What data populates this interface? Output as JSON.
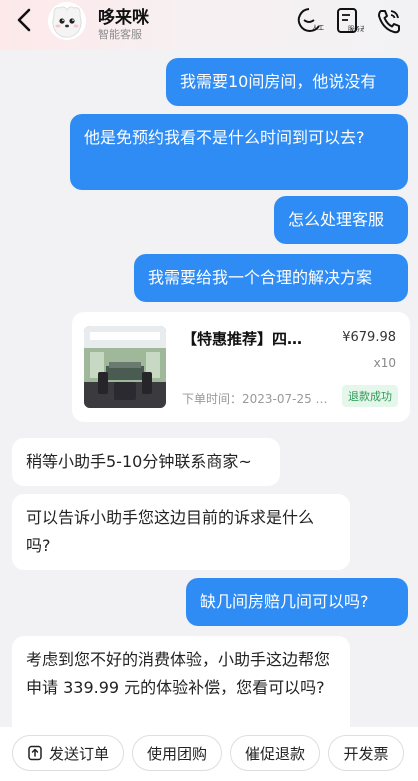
{
  "header": {
    "title": "哆来咪",
    "subtitle": "智能客服",
    "human_service_label": "人工客服",
    "progress_label": "服务进度"
  },
  "messages": [
    {
      "from": "me",
      "text": "我需要10间房间，他说没有"
    },
    {
      "from": "me",
      "text": "他是免预约我看不是什么时间到可以去?"
    },
    {
      "from": "me",
      "text": "怎么处理客服"
    },
    {
      "from": "me",
      "text": "我需要给我一个合理的解决方案"
    },
    {
      "from": "bot",
      "text": "稍等小助手5-10分钟联系商家~"
    },
    {
      "from": "bot",
      "text": "可以告诉小助手您这边目前的诉求是什么吗?"
    },
    {
      "from": "me",
      "text": "缺几间房赔几间可以吗?"
    },
    {
      "from": "bot",
      "text": "考虑到您不好的消费体验，小助手这边帮您申请 339.99 元的体验补偿，您看可以吗?"
    }
  ],
  "order": {
    "name": "【特惠推荐】四…",
    "price": "¥679.98",
    "quantity": "x10",
    "time": "下单时间：2023-07-25 …",
    "status": "退款成功"
  },
  "bottom_actions": [
    {
      "label": "发送订单"
    },
    {
      "label": "使用团购"
    },
    {
      "label": "催促退款"
    },
    {
      "label": "开发票"
    }
  ],
  "colors": {
    "accent": "#2f8cf4",
    "background": "#f2f2f4",
    "refund_status": "#2b9a55"
  }
}
